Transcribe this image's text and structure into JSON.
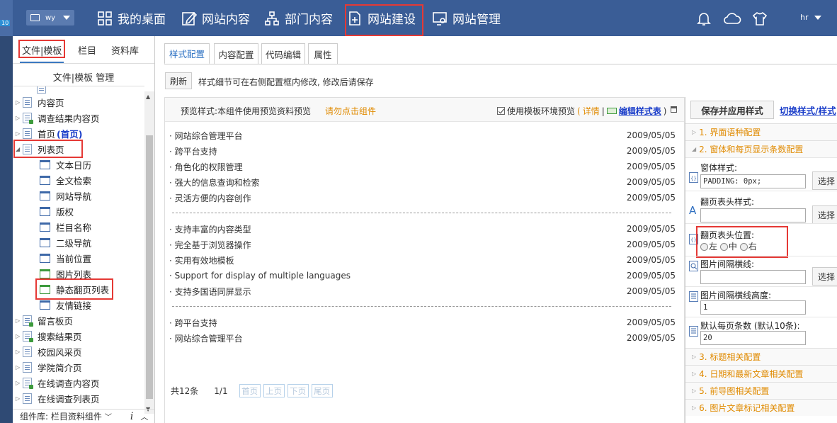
{
  "topbar": {
    "version_badge": "10",
    "site_select_value": "wy",
    "nav": [
      "我的桌面",
      "网站内容",
      "部门内容",
      "网站建设",
      "网站管理"
    ],
    "user": "hr"
  },
  "left": {
    "tabs": [
      "文件|模板",
      "栏目",
      "资料库"
    ],
    "manager_title": "文件|模板 管理",
    "tree": [
      {
        "label": "内容页",
        "level": 0,
        "icon": "doc"
      },
      {
        "label": "调查结果内容页",
        "level": 0,
        "icon": "doc-green"
      },
      {
        "label": "首页",
        "suffix": "(首页)",
        "level": 0,
        "icon": "doc"
      },
      {
        "label": "列表页",
        "level": 0,
        "icon": "doc",
        "expanded": true
      },
      {
        "label": "文本日历",
        "level": 1,
        "icon": "comp"
      },
      {
        "label": "全文检索",
        "level": 1,
        "icon": "comp"
      },
      {
        "label": "网站导航",
        "level": 1,
        "icon": "comp"
      },
      {
        "label": "版权",
        "level": 1,
        "icon": "comp"
      },
      {
        "label": "栏目名称",
        "level": 1,
        "icon": "comp"
      },
      {
        "label": "二级导航",
        "level": 1,
        "icon": "comp"
      },
      {
        "label": "当前位置",
        "level": 1,
        "icon": "comp"
      },
      {
        "label": "图片列表",
        "level": 1,
        "icon": "comp-green"
      },
      {
        "label": "静态翻页列表",
        "level": 1,
        "icon": "comp-green"
      },
      {
        "label": "友情链接",
        "level": 1,
        "icon": "comp"
      },
      {
        "label": "留言板页",
        "level": 0,
        "icon": "doc-green"
      },
      {
        "label": "搜索结果页",
        "level": 0,
        "icon": "doc-green"
      },
      {
        "label": "校园风采页",
        "level": 0,
        "icon": "doc"
      },
      {
        "label": "学院简介页",
        "level": 0,
        "icon": "doc"
      },
      {
        "label": "在线调查内容页",
        "level": 0,
        "icon": "doc-green"
      },
      {
        "label": "在线调查列表页",
        "level": 0,
        "icon": "doc"
      }
    ],
    "library_label": "组件库: 栏目资料组件",
    "info_icon": "i"
  },
  "main": {
    "tabs": [
      "样式配置",
      "内容配置",
      "代码编辑",
      "属性"
    ],
    "refresh_label": "刷新",
    "hint": "样式细节可在右侧配置框内修改, 修改后请保存",
    "preview": {
      "label": "预览样式:本组件使用预览资料预览",
      "warning": "请勿点击组件",
      "use_env": "使用模板环境预览",
      "detail_link": "详情",
      "edit_link": "编辑样式表",
      "groups": [
        [
          {
            "title": "网站综合管理平台",
            "date": "2009/05/05"
          },
          {
            "title": "跨平台支持",
            "date": "2009/05/05"
          },
          {
            "title": "角色化的权限管理",
            "date": "2009/05/05"
          },
          {
            "title": "强大的信息查询和检索",
            "date": "2009/05/05"
          },
          {
            "title": "灵活方便的内容创作",
            "date": "2009/05/05"
          }
        ],
        [
          {
            "title": "支持丰富的内容类型",
            "date": "2009/05/05"
          },
          {
            "title": "完全基于浏览器操作",
            "date": "2009/05/05"
          },
          {
            "title": "实用有效地模板",
            "date": "2009/05/05"
          },
          {
            "title": "Support for display of multiple languages",
            "date": "2009/05/05"
          },
          {
            "title": "支持多国语同屏显示",
            "date": "2009/05/05"
          }
        ],
        [
          {
            "title": "跨平台支持",
            "date": "2009/05/05"
          },
          {
            "title": "网站综合管理平台",
            "date": "2009/05/05"
          }
        ]
      ],
      "pager": {
        "total": "共12条",
        "page": "1/1",
        "buttons": [
          "首页",
          "上页",
          "下页",
          "尾页"
        ]
      }
    }
  },
  "right": {
    "save_label": "保存并应用样式",
    "switch_label": "切换样式/样式",
    "sections": [
      "1. 界面语种配置",
      "2. 窗体和每页显示条数配置"
    ],
    "fields": {
      "window_style": {
        "label": "窗体样式:",
        "value": "PADDING: 0px;",
        "pick": "选择"
      },
      "pager_style": {
        "label": "翻页表头样式:",
        "value": "",
        "pick": "选择"
      },
      "pager_position": {
        "label": "翻页表头位置:",
        "options": [
          "左",
          "中",
          "右"
        ]
      },
      "img_line": {
        "label": "图片间隔横线:",
        "value": "",
        "pick": "选择"
      },
      "img_line_height": {
        "label": "图片间隔横线高度:",
        "value": "1"
      },
      "per_page": {
        "label": "默认每页条数 (默认10条):",
        "value": "20"
      }
    },
    "more_sections": [
      "3. 标题相关配置",
      "4. 日期和最新文章相关配置",
      "5. 前导图相关配置",
      "6. 图片文章标记相关配置"
    ]
  }
}
